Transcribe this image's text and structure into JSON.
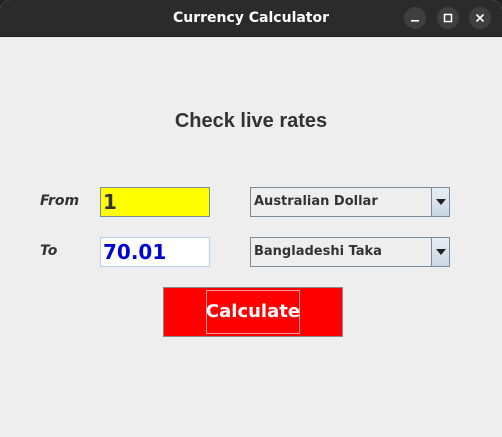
{
  "window": {
    "title": "Currency Calculator",
    "controls": [
      "minimize-icon",
      "maximize-icon",
      "close-icon"
    ]
  },
  "main": {
    "heading": "Check live rates",
    "from": {
      "label": "From",
      "amount": "1",
      "currency": "Australian Dollar"
    },
    "to": {
      "label": "To",
      "amount": "70.01",
      "currency": "Bangladeshi Taka"
    },
    "calculate_label": "Calculate"
  },
  "colors": {
    "titlebar": "#2b2b2b",
    "background": "#eeeeee",
    "from_field_bg": "#ffff00",
    "to_field_text": "#0000cc",
    "calculate_bg": "#ff0000"
  }
}
